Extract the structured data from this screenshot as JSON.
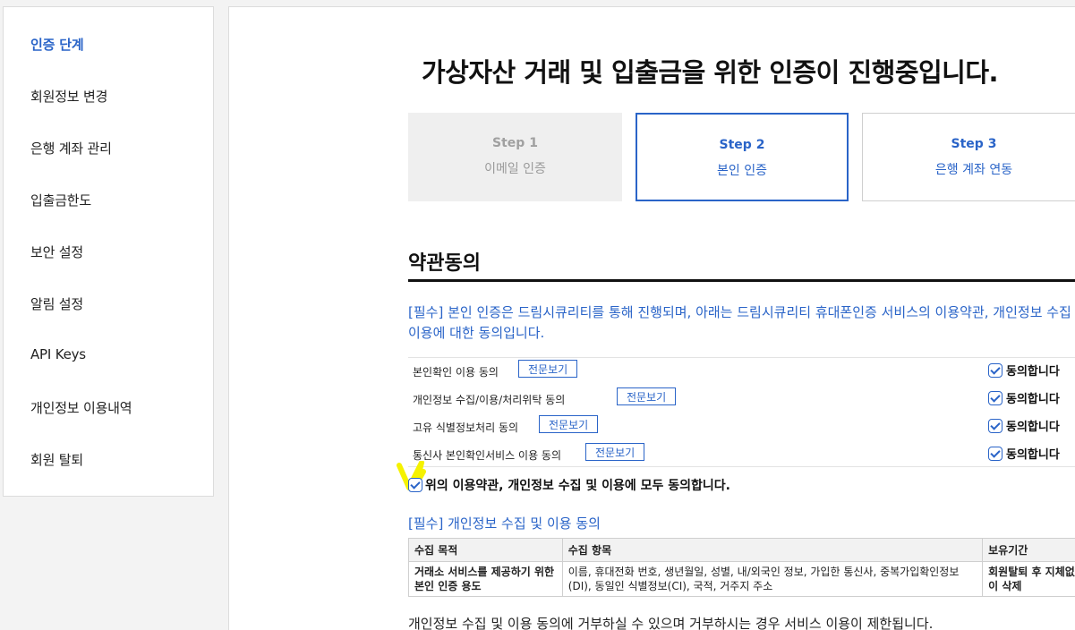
{
  "sidebar": {
    "items": [
      {
        "label": "인증 단계",
        "active": true
      },
      {
        "label": "회원정보 변경"
      },
      {
        "label": "은행 계좌 관리"
      },
      {
        "label": "입출금한도"
      },
      {
        "label": "보안 설정"
      },
      {
        "label": "알림 설정"
      },
      {
        "label": "API Keys"
      },
      {
        "label": "개인정보 이용내역"
      },
      {
        "label": "회원 탈퇴"
      }
    ]
  },
  "main": {
    "title": "가상자산 거래 및 입출금을 위한 인증이 진행중입니다.",
    "steps": [
      {
        "num": "Step 1",
        "label": "이메일 인증",
        "state": "done"
      },
      {
        "num": "Step 2",
        "label": "본인 인증",
        "state": "current"
      },
      {
        "num": "Step 3",
        "label": "은행 계좌 연동",
        "state": "pending"
      }
    ],
    "terms": {
      "title": "약관동의",
      "notice": "[필수] 본인 인증은 드림시큐리티를 통해 진행되며, 아래는 드림시큐리티 휴대폰인증 서비스의 이용약관, 개인정보 수집 및 이용에 대한 동의입니다.",
      "view_label": "전문보기",
      "agree_label": "동의합니다",
      "rows": [
        {
          "name": "본인확인 이용 동의",
          "checked": true
        },
        {
          "name": "개인정보 수집/이용/처리위탁 동의",
          "checked": true
        },
        {
          "name": "고유 식별정보처리 동의",
          "checked": true
        },
        {
          "name": "통신사 본인확인서비스 이용 동의",
          "checked": true
        }
      ],
      "all_agree": "위의 이용약관, 개인정보 수집 및 이용에 모두 동의합니다.",
      "all_agree_checked": true
    },
    "privacy": {
      "title": "[필수] 개인정보 수집 및 이용 동의",
      "headers": [
        "수집 목적",
        "수집 항목",
        "보유기간"
      ],
      "rows": [
        [
          "거래소 서비스를 제공하기 위한 본인 인증 용도",
          "이름, 휴대전화 번호, 생년월일, 성별, 내/외국인 정보, 가입한 통신사, 중복가입확인정보(DI), 동일인 식별정보(CI), 국적, 거주지 주소",
          "회원탈퇴 후 지체없이 삭제"
        ]
      ],
      "note": "개인정보 수집 및 이용 동의에 거부하실 수 있으며 거부하시는 경우 서비스 이용이 제한됩니다."
    }
  },
  "colors": {
    "accent": "#2a64c8",
    "highlight_mark": "#f5f200"
  }
}
